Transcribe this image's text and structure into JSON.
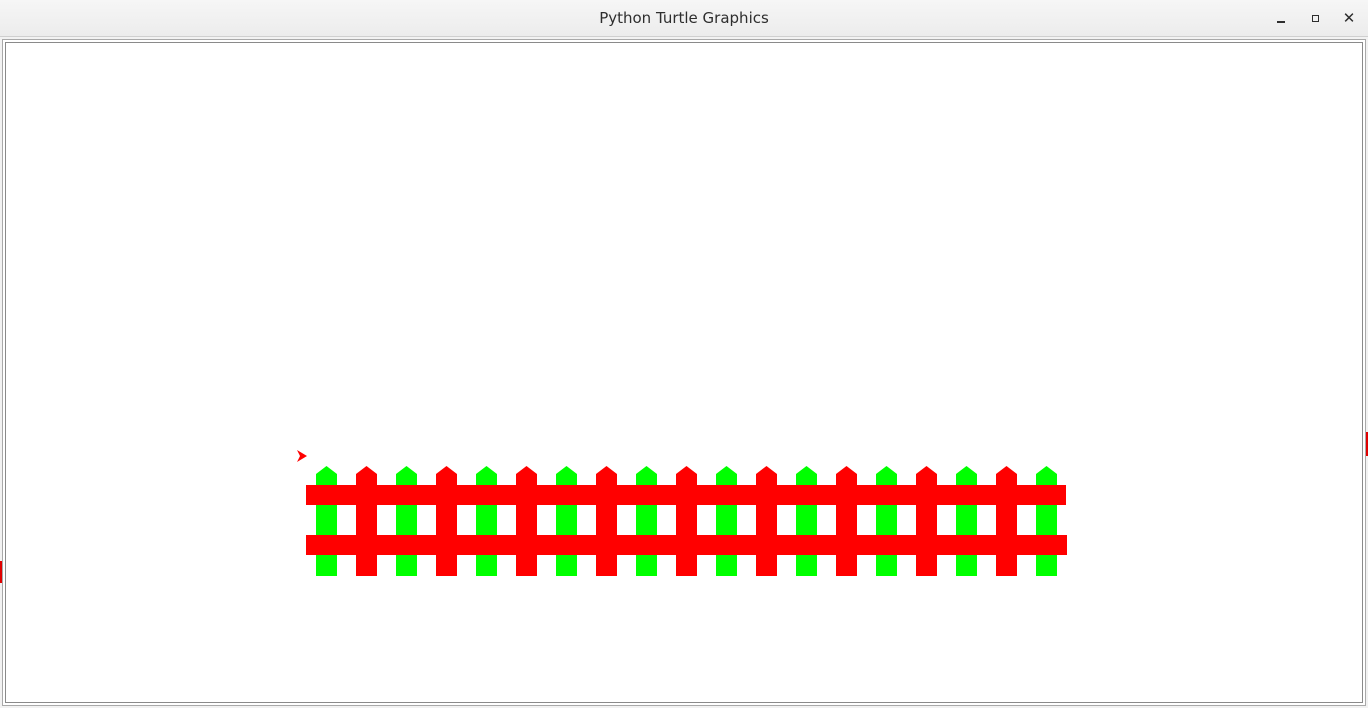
{
  "window": {
    "title": "Python Turtle Graphics"
  },
  "controls": {
    "minimize_icon": "minimize-icon",
    "maximize_icon": "maximize-icon",
    "close_icon": "close-icon",
    "close_glyph": "✕"
  },
  "drawing": {
    "background_color": "#ffffff",
    "picket_colors": [
      "#00ff00",
      "#ff0000"
    ],
    "rail_color": "#ff0000",
    "picket_count": 19,
    "rail_count": 2,
    "turtle_color": "#ff0000",
    "turtle_heading": "east"
  }
}
